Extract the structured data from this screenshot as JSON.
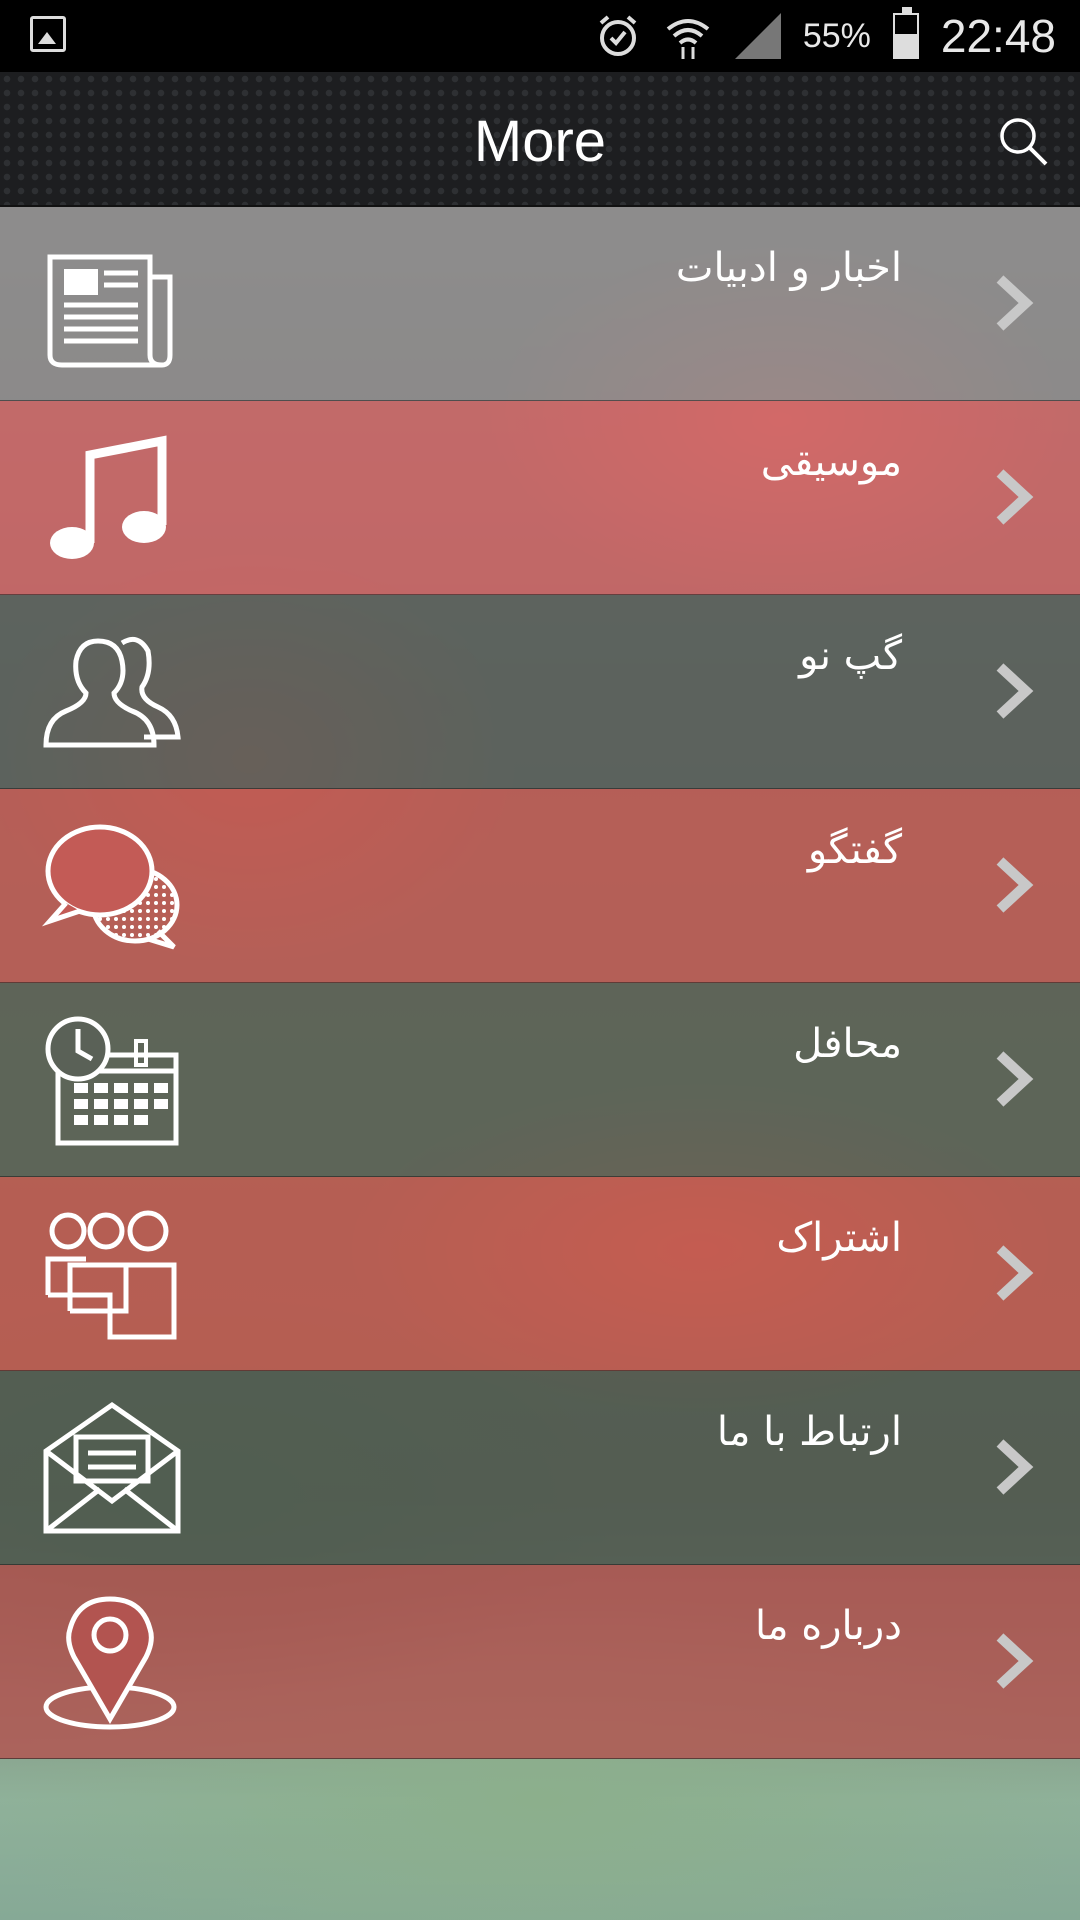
{
  "status_bar": {
    "battery_percent": "55%",
    "time": "22:48",
    "icons": [
      "gallery-icon",
      "alarm-icon",
      "wifi-icon",
      "signal-icon",
      "battery-icon"
    ]
  },
  "app_bar": {
    "title": "More",
    "search_icon": "search-icon"
  },
  "menu": {
    "items": [
      {
        "label": "اخبار و ادبیات",
        "icon": "newspaper-icon",
        "tint": "#8c8c8e"
      },
      {
        "label": "موسیقی",
        "icon": "music-note-icon",
        "tint": "#cf6567"
      },
      {
        "label": "گپ نو",
        "icon": "users-icon",
        "tint": "#56605d"
      },
      {
        "label": "گفتگو",
        "icon": "chat-bubbles-icon",
        "tint": "#c35b56"
      },
      {
        "label": "محافل",
        "icon": "calendar-clock-icon",
        "tint": "#5a6157"
      },
      {
        "label": "اشتراک",
        "icon": "group-share-icon",
        "tint": "#c65a50"
      },
      {
        "label": "ارتباط با ما",
        "icon": "mail-icon",
        "tint": "#4e5a50"
      },
      {
        "label": "درباره ما",
        "icon": "location-pin-icon",
        "tint": "#b25450"
      }
    ]
  },
  "colors": {
    "status_bar_bg": "#000000",
    "app_bar_bg": "#1d1e20",
    "chevron": "#c8c8c8"
  }
}
